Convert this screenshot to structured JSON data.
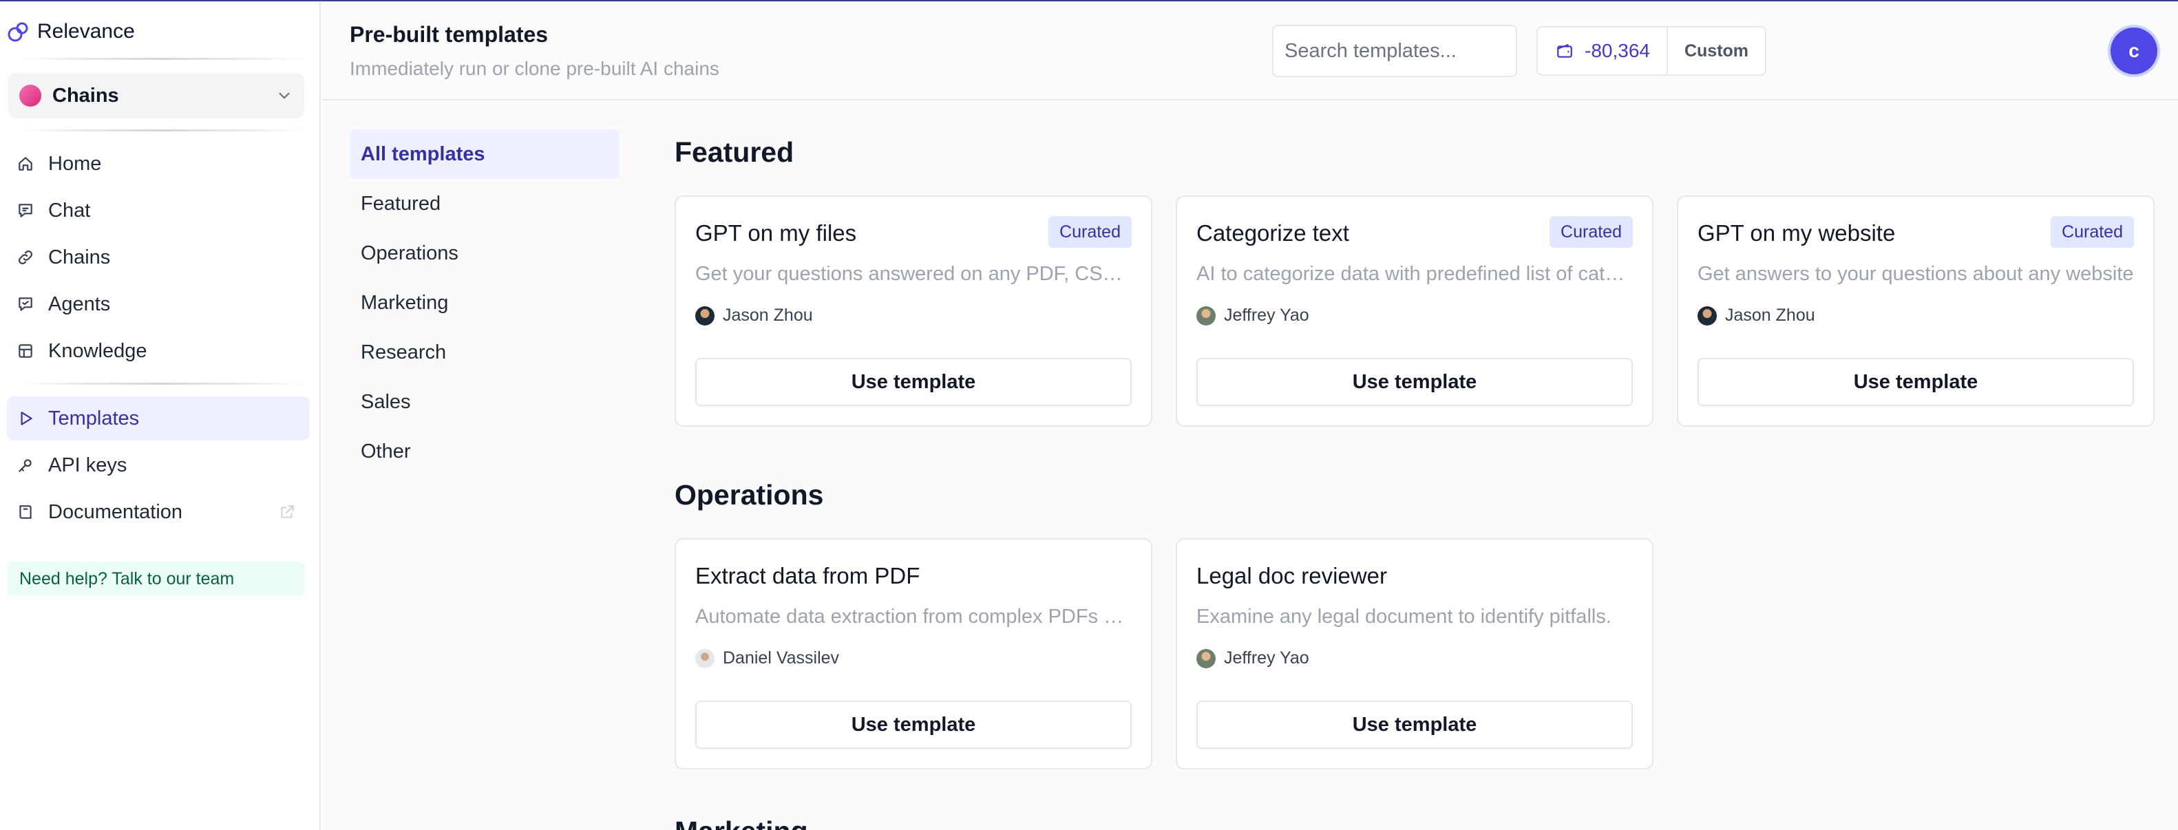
{
  "brand": {
    "name": "Relevance"
  },
  "project_selector": {
    "label": "Chains"
  },
  "nav": [
    {
      "label": "Home",
      "icon": "home-icon"
    },
    {
      "label": "Chat",
      "icon": "chat-icon"
    },
    {
      "label": "Chains",
      "icon": "link-icon"
    },
    {
      "label": "Agents",
      "icon": "agent-icon"
    },
    {
      "label": "Knowledge",
      "icon": "table-icon"
    }
  ],
  "nav2": [
    {
      "label": "Templates",
      "icon": "play-icon",
      "active": true
    },
    {
      "label": "API keys",
      "icon": "key-icon"
    },
    {
      "label": "Documentation",
      "icon": "book-icon",
      "external": true
    }
  ],
  "help": {
    "label": "Need help? Talk to our team"
  },
  "header": {
    "title": "Pre-built templates",
    "subtitle": "Immediately run or clone pre-built AI chains",
    "search_placeholder": "Search templates...",
    "credits": "-80,364",
    "plan": "Custom",
    "avatar_initial": "c"
  },
  "categories": [
    "All templates",
    "Featured",
    "Operations",
    "Marketing",
    "Research",
    "Sales",
    "Other"
  ],
  "sections": {
    "featured": {
      "title": "Featured",
      "cards": [
        {
          "title": "GPT on my files",
          "badge": "Curated",
          "desc": "Get your questions answered on any PDF, CSV, TXT, DOCX file",
          "author": "Jason Zhou",
          "button": "Use template"
        },
        {
          "title": "Categorize text",
          "badge": "Curated",
          "desc": "AI to categorize data with predefined list of categories",
          "author": "Jeffrey Yao",
          "button": "Use template"
        },
        {
          "title": "GPT on my website",
          "badge": "Curated",
          "desc": "Get answers to your questions about any website",
          "author": "Jason Zhou",
          "button": "Use template"
        }
      ]
    },
    "operations": {
      "title": "Operations",
      "cards": [
        {
          "title": "Extract data from PDF",
          "desc": "Automate data extraction from complex PDFs and documents",
          "author": "Daniel Vassilev",
          "button": "Use template"
        },
        {
          "title": "Legal doc reviewer",
          "desc": "Examine any legal document to identify pitfalls.",
          "author": "Jeffrey Yao",
          "button": "Use template"
        }
      ]
    },
    "next_section_title": "Marketing"
  },
  "colors": {
    "accent": "#4f46e5",
    "active_bg": "#eef0ff",
    "badge_bg": "#e0e7ff",
    "help_bg": "#ecfdf5"
  }
}
